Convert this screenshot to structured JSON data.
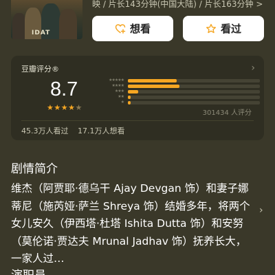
{
  "movie": {
    "poster_title": "IDAT",
    "meta": "映 / 片长143分钟(中国大陆) / 片长163分钟 >"
  },
  "actions": {
    "want_label": "想看",
    "seen_label": "看过"
  },
  "rating": {
    "title": "豆瓣评分®",
    "score": "8.7",
    "stars": 4.5,
    "distribution": [
      {
        "stars": "★★★★★",
        "fraction": 0.37
      },
      {
        "stars": "★★★★",
        "fraction": 0.39
      },
      {
        "stars": "★★★",
        "fraction": 0.08
      },
      {
        "stars": "★★",
        "fraction": 0.02
      },
      {
        "stars": "★",
        "fraction": 0.02
      }
    ],
    "count_text": "301434 人评分",
    "seen_text": "45.3万人看过",
    "want_text": "17.1万人想看"
  },
  "synopsis": {
    "title": "剧情简介",
    "text": "维杰（阿贾耶·德乌干 Ajay Devgan 饰）和妻子娜蒂尼（施芮娅·萨兰 Shreya 饰）结婚多年，将两个女儿安久（伊西塔·杜塔 Ishita Dutta 饰）和安努（莫伦诺·贾达夫 Mrunal Jadhav 饰）抚养长大，一家人过…"
  },
  "next_section": {
    "title": "演职员"
  },
  "colors": {
    "background": "#3a3829",
    "card": "#2f2e22",
    "accent": "#f5a623"
  }
}
